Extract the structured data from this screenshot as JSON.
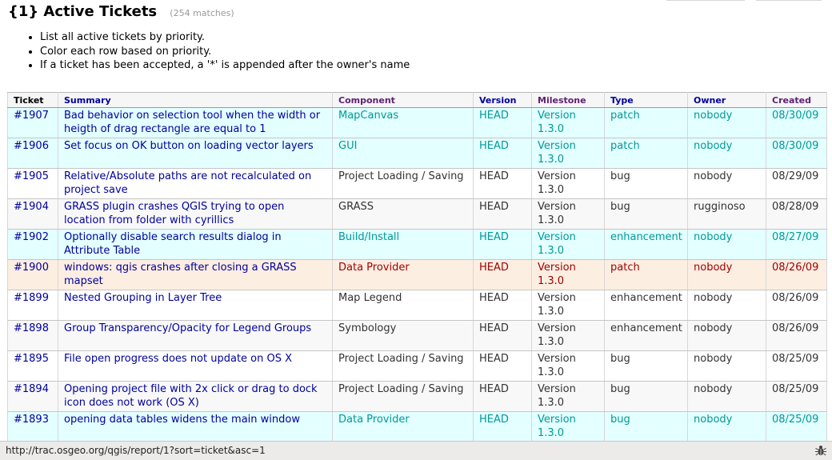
{
  "report": {
    "title": "{1} Active Tickets",
    "matches": "(254 matches)"
  },
  "description": [
    "List all active tickets by priority.",
    "Color each row based on priority.",
    "If a ticket has been accepted, a '*' is appended after the owner's name"
  ],
  "table": {
    "headers": [
      "Ticket",
      "Summary",
      "Component",
      "Version",
      "Milestone",
      "Type",
      "Owner",
      "Created"
    ],
    "rows": [
      {
        "ticket": "#1907",
        "summary": "Bad behavior on selection tool when the width or heigth of drag rectangle are equal to 1",
        "component": "MapCanvas",
        "version": "HEAD",
        "milestone": "Version 1.3.0",
        "type": "patch",
        "owner": "nobody",
        "created": "08/30/09",
        "color": "cyan"
      },
      {
        "ticket": "#1906",
        "summary": "Set focus on OK button on loading vector layers",
        "component": "GUI",
        "version": "HEAD",
        "milestone": "Version 1.3.0",
        "type": "patch",
        "owner": "nobody",
        "created": "08/30/09",
        "color": "cyan"
      },
      {
        "ticket": "#1905",
        "summary": "Relative/Absolute paths are not recalculated on project save",
        "component": "Project Loading / Saving",
        "version": "HEAD",
        "milestone": "Version 1.3.0",
        "type": "bug",
        "owner": "nobody",
        "created": "08/29/09",
        "color": "white"
      },
      {
        "ticket": "#1904",
        "summary": "GRASS plugin crashes QGIS trying to open location from folder with cyrillics",
        "component": "GRASS",
        "version": "HEAD",
        "milestone": "Version 1.3.0",
        "type": "bug",
        "owner": "rugginoso",
        "created": "08/28/09",
        "color": "gray"
      },
      {
        "ticket": "#1902",
        "summary": "Optionally disable search results dialog in Attribute Table",
        "component": "Build/Install",
        "version": "HEAD",
        "milestone": "Version 1.3.0",
        "type": "enhancement",
        "owner": "nobody",
        "created": "08/27/09",
        "color": "cyan"
      },
      {
        "ticket": "#1900",
        "summary": "windows: qgis crashes after closing a GRASS mapset",
        "component": "Data Provider",
        "version": "HEAD",
        "milestone": "Version 1.3.0",
        "type": "patch",
        "owner": "nobody",
        "created": "08/26/09",
        "color": "red"
      },
      {
        "ticket": "#1899",
        "summary": "Nested Grouping in Layer Tree",
        "component": "Map Legend",
        "version": "HEAD",
        "milestone": "Version 1.3.0",
        "type": "enhancement",
        "owner": "nobody",
        "created": "08/26/09",
        "color": "white"
      },
      {
        "ticket": "#1898",
        "summary": "Group Transparency/Opacity for Legend Groups",
        "component": "Symbology",
        "version": "HEAD",
        "milestone": "Version 1.3.0",
        "type": "enhancement",
        "owner": "nobody",
        "created": "08/26/09",
        "color": "gray"
      },
      {
        "ticket": "#1895",
        "summary": "File open progress does not update on OS X",
        "component": "Project Loading / Saving",
        "version": "HEAD",
        "milestone": "Version 1.3.0",
        "type": "bug",
        "owner": "nobody",
        "created": "08/25/09",
        "color": "white"
      },
      {
        "ticket": "#1894",
        "summary": "Opening project file with 2x click or drag to dock icon does not work (OS X)",
        "component": "Project Loading / Saving",
        "version": "HEAD",
        "milestone": "Version 1.3.0",
        "type": "bug",
        "owner": "nobody",
        "created": "08/25/09",
        "color": "gray"
      },
      {
        "ticket": "#1893",
        "summary": "opening data tables widens the main window",
        "component": "Data Provider",
        "version": "HEAD",
        "milestone": "Version 1.3.0",
        "type": "bug",
        "owner": "nobody",
        "created": "08/25/09",
        "color": "cyan"
      }
    ]
  },
  "statusbar": {
    "url": "http://trac.osgeo.org/qgis/report/1?sort=ticket&asc=1",
    "icon": "bug-icon"
  },
  "colors": {
    "cyan_row": "#e3ffff",
    "red_row": "#fdeee2",
    "link": "#00009c",
    "visited_header": "#5e1e73"
  }
}
